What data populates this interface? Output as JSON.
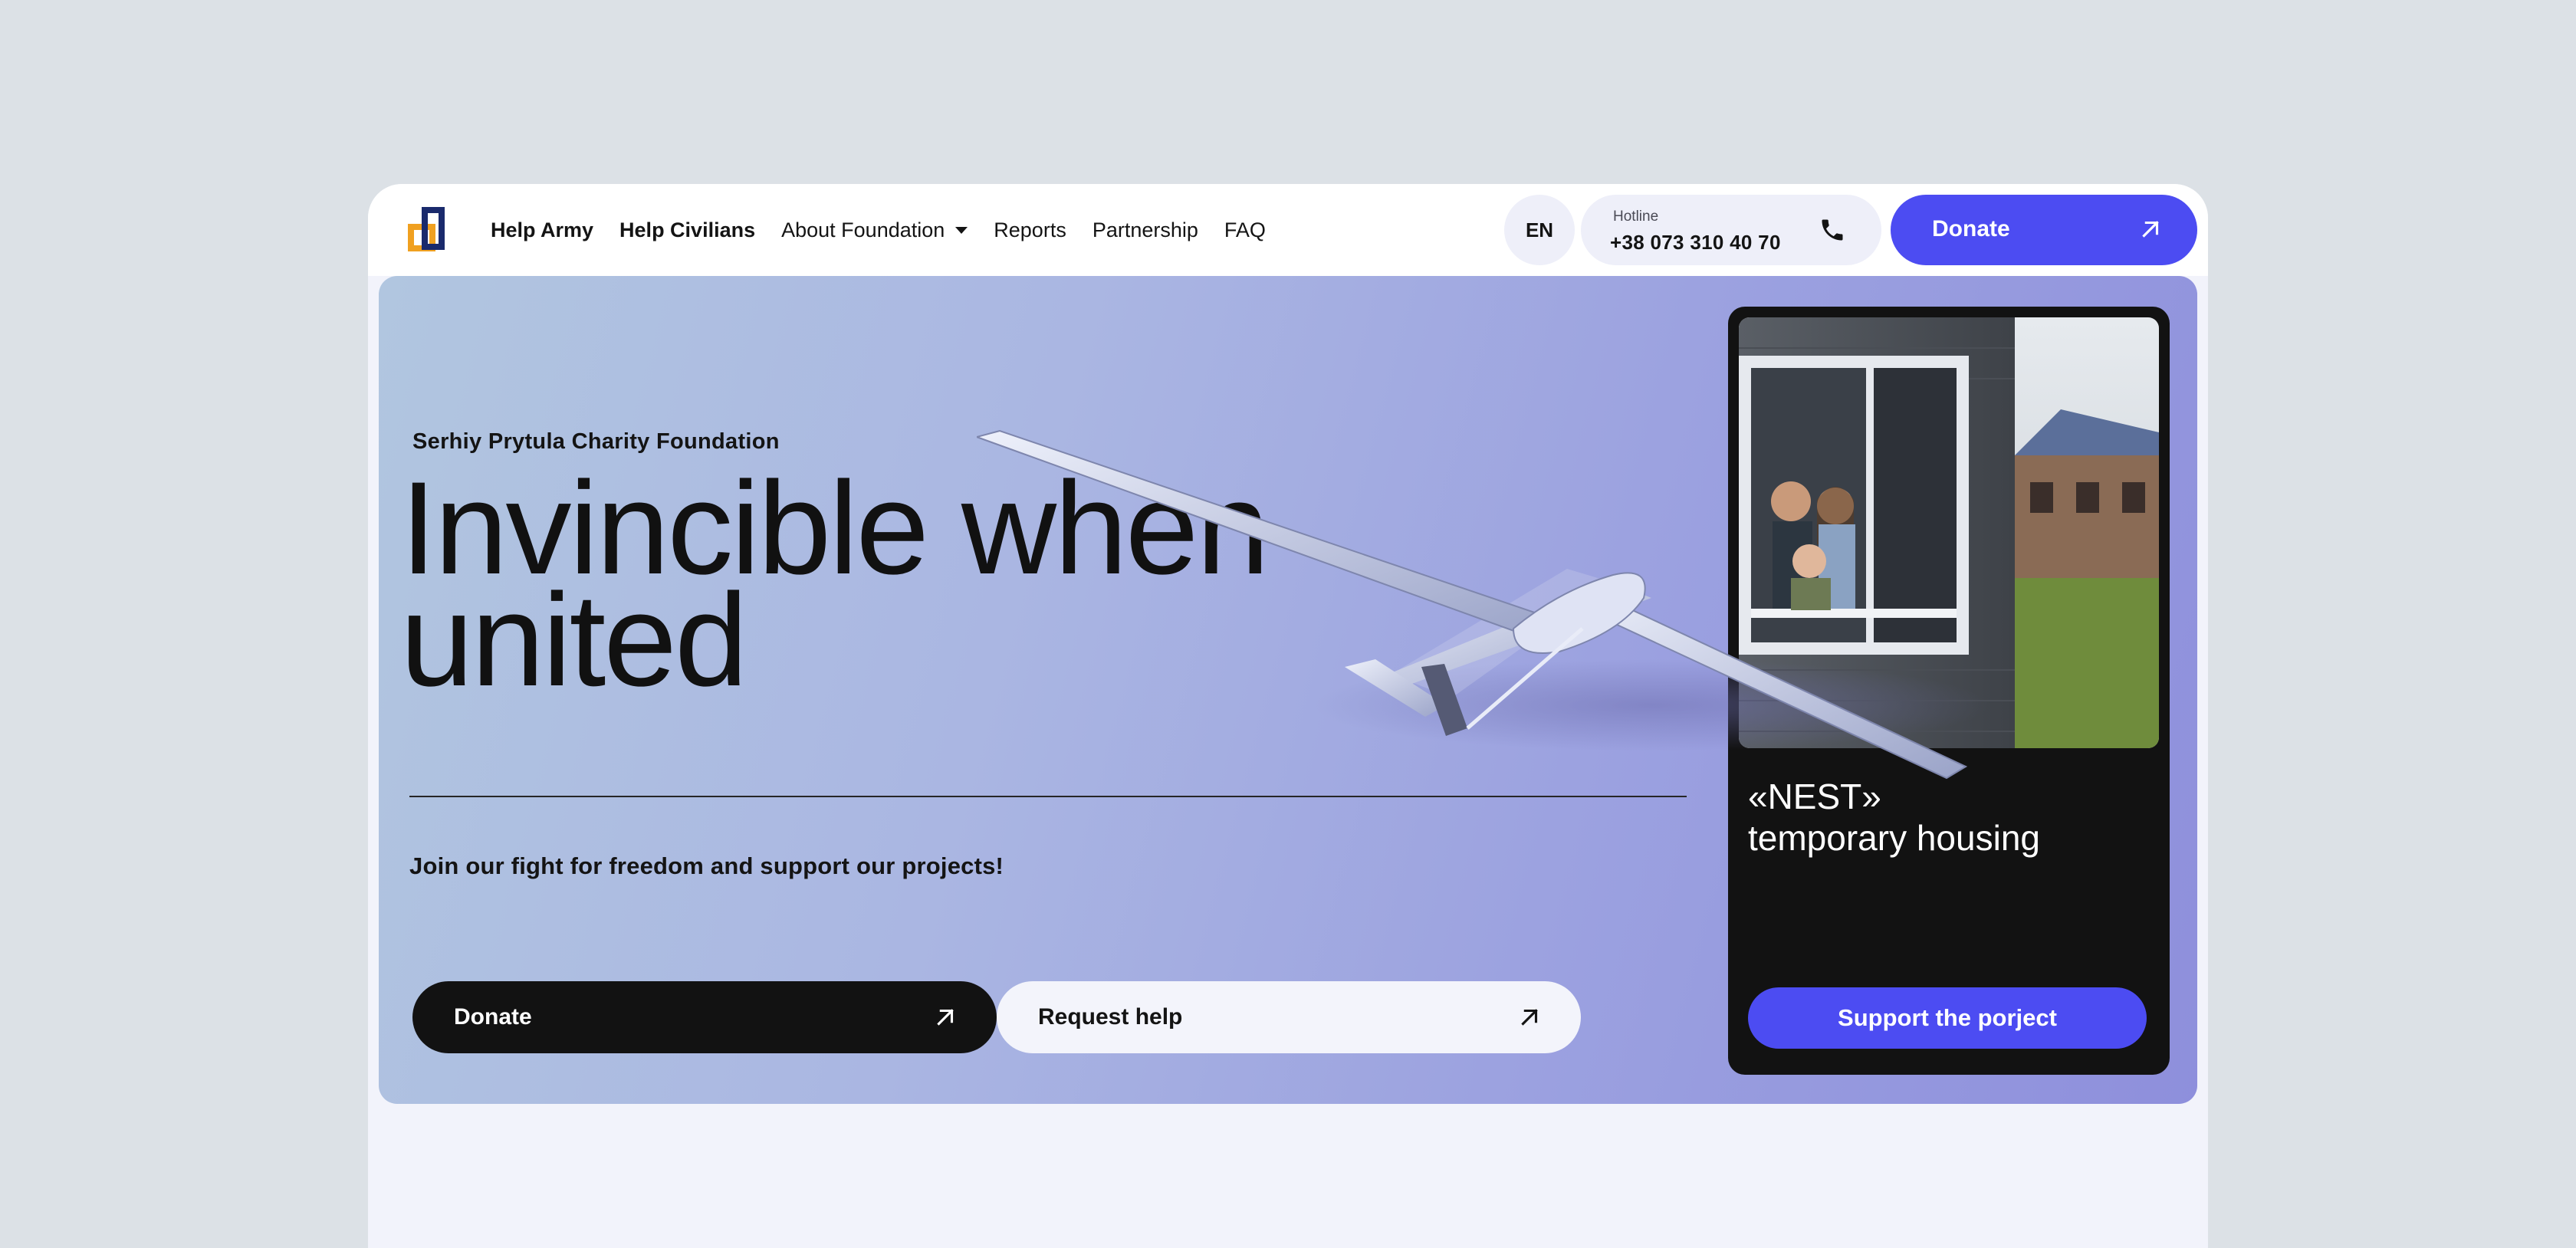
{
  "header": {
    "nav": [
      {
        "label": "Help Army"
      },
      {
        "label": "Help Civilians"
      },
      {
        "label": "About Foundation"
      },
      {
        "label": "Reports"
      },
      {
        "label": "Partnership"
      },
      {
        "label": "FAQ"
      }
    ],
    "language": "EN",
    "hotline": {
      "caption": "Hotline",
      "number": "+38 073 310 40 70"
    },
    "donate_label": "Donate"
  },
  "hero": {
    "tagline": "Serhiy Prytula Charity Foundation",
    "title_line1": "Invincible when",
    "title_line2": "united",
    "subtitle": "Join our fight for freedom and support our projects!",
    "donate_label": "Donate",
    "request_help_label": "Request help"
  },
  "promo": {
    "title_line1": "«NEST»",
    "title_line2": "temporary housing",
    "button_label": "Support the porject"
  },
  "colors": {
    "accent": "#4c4cf2",
    "dark": "#121212",
    "logo_navy": "#1a2a6c",
    "logo_orange": "#f0a020"
  },
  "icons": {
    "logo": "foundation-logo-icon",
    "caret": "caret-down-icon",
    "phone": "phone-icon",
    "arrow": "arrow-up-right-icon"
  }
}
